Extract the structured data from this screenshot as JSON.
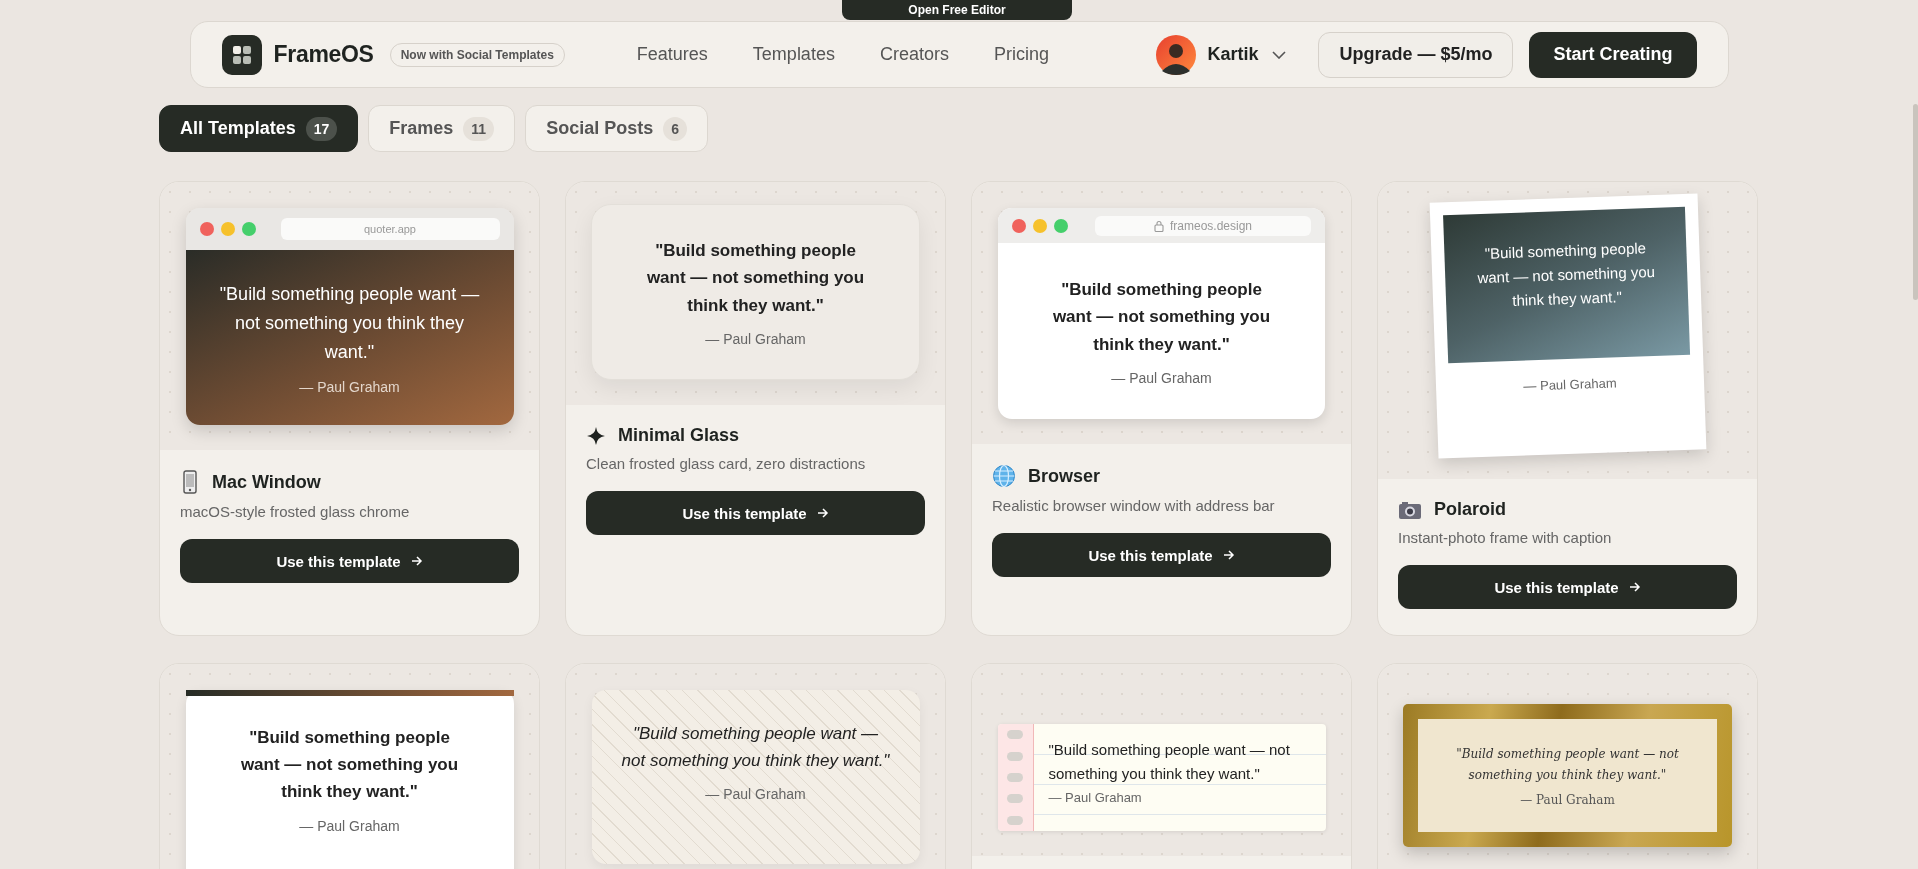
{
  "editor_button": {
    "label": "Open Free Editor"
  },
  "brand": {
    "name": "FrameOS",
    "badge": "Now with Social Templates"
  },
  "nav": [
    "Features",
    "Templates",
    "Creators",
    "Pricing"
  ],
  "user": {
    "name": "Kartik"
  },
  "actions": [
    {
      "label": "Upgrade — $5/mo",
      "kind": "secondary"
    },
    {
      "label": "Start Creating",
      "kind": "primary"
    }
  ],
  "filters": [
    {
      "label": "All Templates",
      "count": "17",
      "selected": true
    },
    {
      "label": "Frames",
      "count": "11",
      "selected": false
    },
    {
      "label": "Social Posts",
      "count": "6",
      "selected": false
    }
  ],
  "templates": [
    {
      "kind": "mac",
      "url": "quoter.app",
      "quote": "\"Build something people want — not something you think they want.\"",
      "author": "— Paul Graham",
      "title": "Mac Window",
      "description": "macOS-style frosted glass chrome",
      "button": "Use this template"
    },
    {
      "kind": "glass",
      "quote": "\"Build something people want — not something you think they want.\"",
      "author": "— Paul Graham",
      "title": "Minimal Glass",
      "description": "Clean frosted glass card, zero distractions",
      "button": "Use this template"
    },
    {
      "kind": "browser",
      "url": "frameos.design",
      "quote": "\"Build something people want — not something you think they want.\"",
      "author": "— Paul Graham",
      "title": "Browser",
      "description": "Realistic browser window with address bar",
      "button": "Use this template"
    },
    {
      "kind": "polaroid",
      "quote": "\"Build something people want — not something you think they want.\"",
      "author": "— Paul Graham",
      "title": "Polaroid",
      "description": "Instant-photo frame with caption",
      "button": "Use this template"
    },
    {
      "kind": "gradient",
      "quote": "\"Build something people want — not something you think they want.\"",
      "author": "— Paul Graham"
    },
    {
      "kind": "paper",
      "quote": "\"Build something people want — not something you think they want.\"",
      "author": "— Paul Graham"
    },
    {
      "kind": "notebook",
      "quote": "\"Build something people want — not something you think they want.\"",
      "author": "— Paul Graham"
    },
    {
      "kind": "gold",
      "quote": "\"Build something people want — not something you think they want.\"",
      "author": "— Paul Graham"
    }
  ]
}
